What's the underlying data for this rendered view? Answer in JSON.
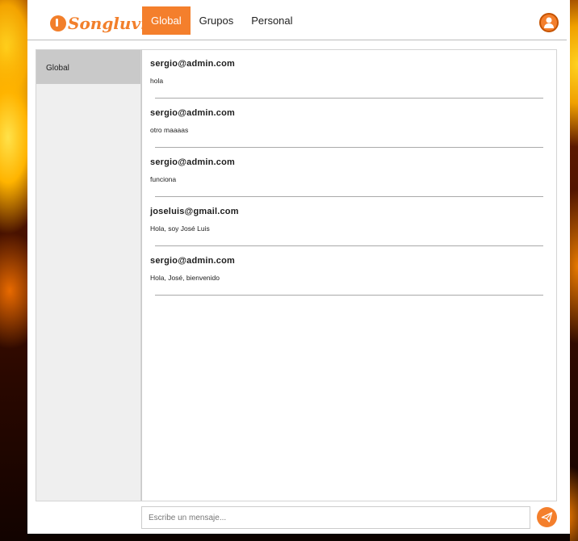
{
  "brand": {
    "name": "Songluvr"
  },
  "colors": {
    "accent": "#f47f2c",
    "sidebar": "#efefef",
    "sidebar_active": "#c9c9c9"
  },
  "nav": {
    "tabs": [
      {
        "label": "Global",
        "active": true
      },
      {
        "label": "Grupos",
        "active": false
      },
      {
        "label": "Personal",
        "active": false
      }
    ]
  },
  "sidebar": {
    "items": [
      {
        "label": "Global",
        "active": true
      }
    ]
  },
  "messages": [
    {
      "author": "sergio@admin.com",
      "text": "hola"
    },
    {
      "author": "sergio@admin.com",
      "text": "otro maaaas"
    },
    {
      "author": "sergio@admin.com",
      "text": "funciona"
    },
    {
      "author": "joseluis@gmail.com",
      "text": "Hola, soy José Luis"
    },
    {
      "author": "sergio@admin.com",
      "text": "Hola, José, bienvenido"
    }
  ],
  "composer": {
    "placeholder": "Escribe un mensaje..."
  },
  "icons": {
    "user": "user-avatar-icon",
    "send": "paper-plane-icon"
  }
}
